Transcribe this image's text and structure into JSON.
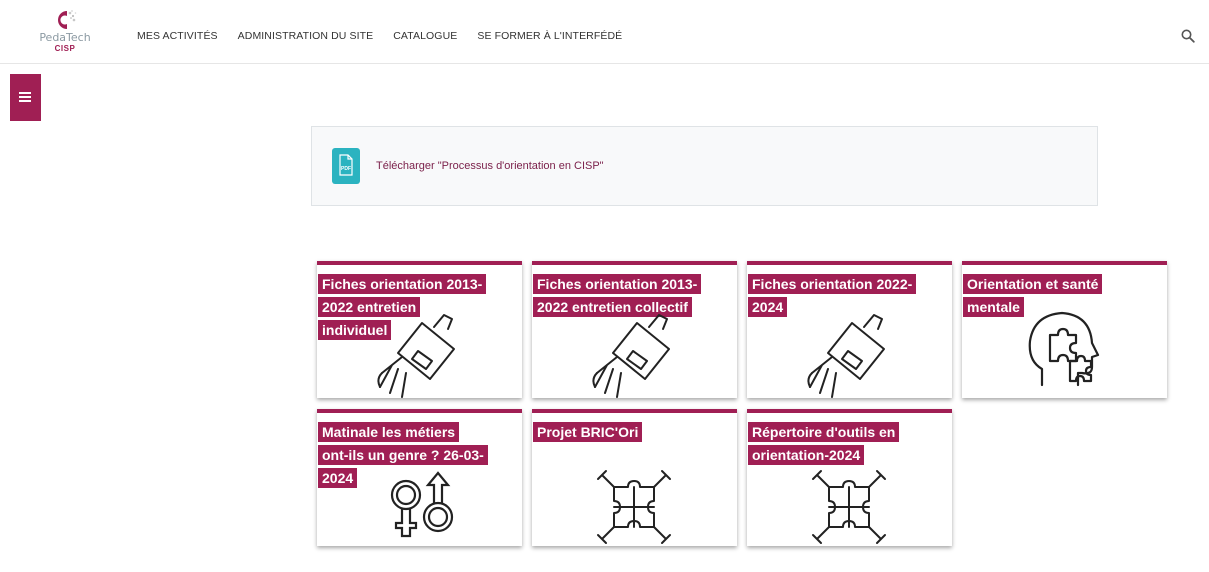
{
  "brand": {
    "name_line1": "PedaTech",
    "name_line2": "CISP",
    "accent": "#a01f54"
  },
  "nav": {
    "items": [
      "MES ACTIVITÉS",
      "ADMINISTRATION DU SITE",
      "CATALOGUE",
      "SE FORMER À L'INTERFÉDÉ"
    ]
  },
  "header": {
    "search_icon": "search-icon"
  },
  "drawer": {
    "icon": "list-icon"
  },
  "download": {
    "icon": "pdf-file-icon",
    "link_text": "Télécharger \"Processus d'orientation en CISP\""
  },
  "tiles": [
    {
      "title": "Fiches orientation 2013-2022 entretien individuel",
      "lines": [
        "Fiches orientation 2013-",
        "2022 entretien",
        "individuel"
      ],
      "icon": "hand-holding-paper-icon"
    },
    {
      "title": "Fiches orientation 2013-2022 entretien collectif",
      "lines": [
        "Fiches orientation 2013-",
        "2022 entretien collectif"
      ],
      "icon": "hand-holding-paper-icon"
    },
    {
      "title": "Fiches orientation 2022-2024",
      "lines": [
        "Fiches orientation 2022-",
        "2024"
      ],
      "icon": "hand-holding-paper-icon"
    },
    {
      "title": "Orientation et santé mentale",
      "lines": [
        "Orientation et santé",
        "mentale"
      ],
      "icon": "head-puzzle-icon"
    },
    {
      "title": "Matinale les métiers ont-ils un genre ? 26-03-2024",
      "lines": [
        "Matinale les métiers",
        "ont-ils un genre ? 26-03-",
        "2024"
      ],
      "icon": "gender-symbols-icon"
    },
    {
      "title": "Projet BRIC'Ori",
      "lines": [
        "Projet BRIC'Ori"
      ],
      "icon": "hands-puzzle-icon"
    },
    {
      "title": "Répertoire d'outils en orientation-2024",
      "lines": [
        "Répertoire d'outils en",
        "orientation-2024"
      ],
      "icon": "hands-puzzle-icon"
    }
  ]
}
